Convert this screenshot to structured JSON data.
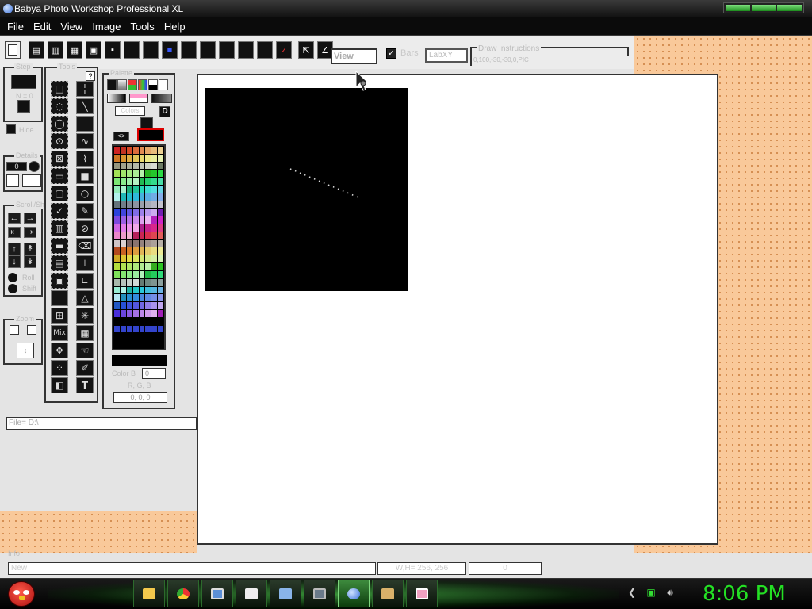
{
  "app": {
    "title": "Babya Photo Workshop Professional XL"
  },
  "menu": [
    "File",
    "Edit",
    "View",
    "Image",
    "Tools",
    "Help"
  ],
  "toolbar": {
    "view_label": "View",
    "bars_label": "Bars",
    "bars_checked": true,
    "labxy_label": "LabXY",
    "draw_instructions_title": "Draw Instructions",
    "draw_instructions_text": "0,100,-30,-30,0,PIC"
  },
  "step_panel": {
    "title": "Step",
    "n_label": "N = 0",
    "hide_label": "Hide"
  },
  "details_panel": {
    "title": "Details",
    "value": "0"
  },
  "scroll_panel": {
    "title": "Scroll/Shift",
    "roll_label": "Roll",
    "shift_label": "Shift"
  },
  "zoom_panel": {
    "title": "Zoom"
  },
  "tools_panel": {
    "title": "Tools",
    "help": "?"
  },
  "palette_panel": {
    "title": "Palette",
    "swap_label": "<>",
    "default_label": "D",
    "color_label": "Color B",
    "color_value": "0",
    "rgb_label": "R, G, B",
    "rgb_value": "0, 0, 0",
    "name_field": "Colors"
  },
  "file_path": "File= D:\\",
  "status": {
    "title": "Info",
    "message": "New",
    "dimensions": "W,H= 256, 256",
    "value": "0"
  },
  "taskbar": {
    "clock": "8:06 PM",
    "icons": [
      "folder-icon",
      "chrome-icon",
      "photo-viewer-icon",
      "terminal-icon",
      "network-icon",
      "monitor-icon",
      "babya-photo-icon",
      "printer-icon",
      "image-icon"
    ]
  },
  "colors": {
    "title_bg": "#111111",
    "menu_bg": "#0b0b0b",
    "workspace_bg": "#f9c99a",
    "clock": "#24e024",
    "taskbar_glow": "#5aff5a",
    "primary_color": "#000000",
    "secondary_color": "#000000"
  }
}
